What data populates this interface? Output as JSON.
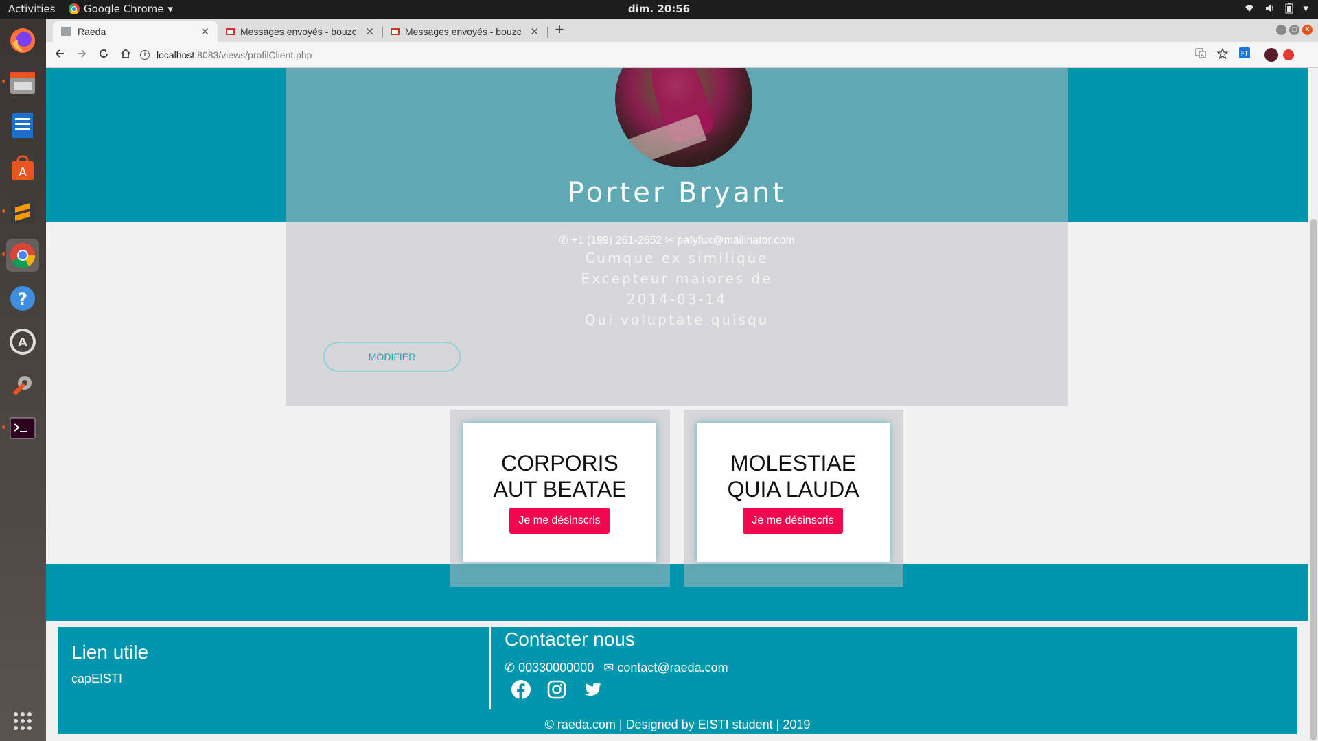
{
  "topbar": {
    "activities": "Activities",
    "app_name": "Google Chrome",
    "clock": "dim. 20:56"
  },
  "browser": {
    "tabs": [
      {
        "title": "Raeda",
        "active": true
      },
      {
        "title": "Messages envoyés - bouzc",
        "active": false
      },
      {
        "title": "Messages envoyés - bouzc",
        "active": false
      }
    ],
    "url_host": "localhost",
    "url_path": ":8083/views/profilClient.php"
  },
  "profile": {
    "name": "Porter Bryant",
    "phone": "+1 (199) 261-2652",
    "email": "pafyfux@mailinator.com",
    "line1": "Cumque ex similique",
    "line2": "Excepteur maiores de",
    "line3": "2014-03-14",
    "line4": "Qui voluptate quisqu",
    "modify_label": "MODIFIER"
  },
  "events": [
    {
      "title_line1": "CORPORIS",
      "title_line2": "AUT BEATAE",
      "button": "Je me désinscris"
    },
    {
      "title_line1": "MOLESTIAE",
      "title_line2": "QUIA LAUDA",
      "button": "Je me désinscris"
    }
  ],
  "footer": {
    "links_title": "Lien utile",
    "link1": "capEISTI",
    "contact_title": "Contacter nous",
    "phone": "00330000000",
    "email": "contact@raeda.com",
    "copyright": "© raeda.com | Designed by EISTI student | 2019"
  },
  "colors": {
    "teal": "#0097ae",
    "card_teal": "#5fa9b4",
    "button_red": "#f2084e"
  }
}
